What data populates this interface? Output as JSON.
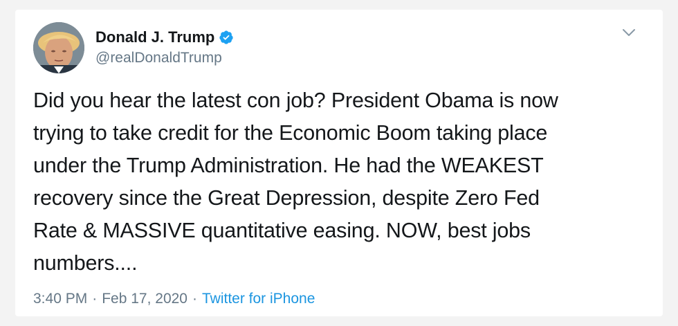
{
  "tweet": {
    "author": {
      "display_name": "Donald J. Trump",
      "handle": "@realDonaldTrump",
      "verified": true,
      "avatar_icon": "profile-photo"
    },
    "text": "Did you hear the latest con job? President Obama is now\ntrying to take credit for the Economic Boom taking place\nunder the Trump Administration. He had the WEAKEST\nrecovery since the Great Depression, despite Zero Fed\nRate & MASSIVE quantitative easing. NOW, best jobs\nnumbers....",
    "time": "3:40 PM",
    "separator": "·",
    "date": "Feb 17, 2020",
    "source": "Twitter for iPhone",
    "menu_icon": "chevron-down-icon"
  },
  "colors": {
    "text_primary": "#14171a",
    "text_secondary": "#657786",
    "link": "#1b95e0",
    "verified_badge": "#1da1f2",
    "background": "#f3f3f3",
    "card": "#ffffff"
  }
}
